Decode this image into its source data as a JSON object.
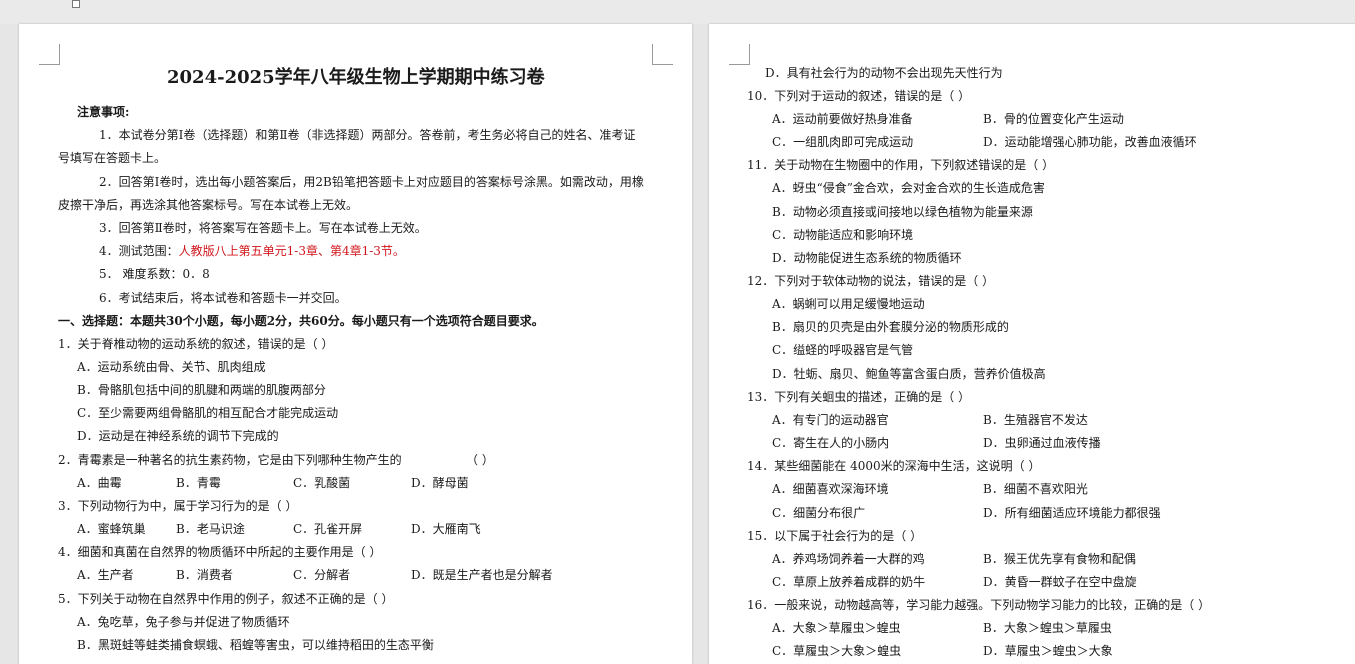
{
  "left": {
    "title": "2024-2025学年八年级生物上学期期中练习卷",
    "notice_heading": "注意事项:",
    "n1a": "1．本试卷分第Ⅰ卷（选择题）和第Ⅱ卷（非选择题）两部分。答卷前，考生务必将自己的姓名、准考证",
    "n1b": "号填写在答题卡上。",
    "n2a": "2．回答第Ⅰ卷时，选出每小题答案后，用2B铅笔把答题卡上对应题目的答案标号涂黑。如需改动，用橡",
    "n2b": "皮擦干净后，再选涂其他答案标号。写在本试卷上无效。",
    "n3": "3．回答第Ⅱ卷时，将答案写在答题卡上。写在本试卷上无效。",
    "n4_prefix": "4．测试范围：",
    "n4_range": "人教版八上第五单元1-3章、第4章1-3节。",
    "n5": "5．  难度系数：0．8",
    "n6": "6．考试结束后，将本试卷和答题卡一并交回。",
    "section": "一、选择题：本题共30个小题，每小题2分，共60分。每小题只有一个选项符合题目要求。",
    "q1": "1．关于脊椎动物的运动系统的叙述，错误的是（    ）",
    "q1A": "A．运动系统由骨、关节、肌肉组成",
    "q1B": "B．骨骼肌包括中间的肌腱和两端的肌腹两部分",
    "q1C": "C．至少需要两组骨骼肌的相互配合才能完成运动",
    "q1D": "D．运动是在神经系统的调节下完成的",
    "q2": "2．青霉素是一种著名的抗生素药物，它是由下列哪种生物产生的",
    "q2p": "（       ）",
    "q2A": "A．曲霉",
    "q2B": "B．青霉",
    "q2C": "C．乳酸菌",
    "q2D": "D．酵母菌",
    "q3": "3．下列动物行为中，属于学习行为的是（     ）",
    "q3A": "A．蜜蜂筑巢",
    "q3B": "B．老马识途",
    "q3C": "C．孔雀开屏",
    "q3D": "D．大雁南飞",
    "q4": "4．细菌和真菌在自然界的物质循环中所起的主要作用是（               ）",
    "q4A": "A．生产者",
    "q4B": "B．消费者",
    "q4C": "C．分解者",
    "q4D": "D．既是生产者也是分解者",
    "q5": "5．下列关于动物在自然界中作用的例子，叙述不正确的是（     ）",
    "q5A": "A．兔吃草，兔子参与并促进了物质循环",
    "q5B": "B．黑斑蛙等蛙类捕食螟蛾、稻蝗等害虫，可以维持稻田的生态平衡"
  },
  "right": {
    "q9D": "D．具有社会行为的动物不会出现先天性行为",
    "q10": "10．下列对于运动的叙述，错误的是（          ）",
    "q10A": "A．运动前要做好热身准备",
    "q10B": "B．骨的位置变化产生运动",
    "q10C": "C．一组肌肉即可完成运动",
    "q10D": "D．运动能增强心肺功能，改善血液循环",
    "q11": "11．关于动物在生物圈中的作用，下列叙述错误的是（      ）",
    "q11A": "A．蚜虫“侵食”金合欢，会对金合欢的生长造成危害",
    "q11B": "B．动物必须直接或间接地以绿色植物为能量来源",
    "q11C": "C．动物能适应和影响环境",
    "q11D": "D．动物能促进生态系统的物质循环",
    "q12": "12．下列对于软体动物的说法，错误的是（          ）",
    "q12A": "A．蜗蜊可以用足缓慢地运动",
    "q12B": "B．扇贝的贝壳是由外套膜分泌的物质形成的",
    "q12C": "C．缢蛏的呼吸器官是气管",
    "q12D": "D．牡蛎、扇贝、鲍鱼等富含蛋白质，营养价值极高",
    "q13": "13．下列有关蛔虫的描述，正确的是（      ）",
    "q13A": "A．有专门的运动器官",
    "q13B": "B．生殖器官不发达",
    "q13C": "C．寄生在人的小肠内",
    "q13D": "D．虫卵通过血液传播",
    "q14": "14．某些细菌能在 4000米的深海中生活，这说明（       ）",
    "q14A": "A．细菌喜欢深海环境",
    "q14B": "B．细菌不喜欢阳光",
    "q14C": "C．细菌分布很广",
    "q14D": "D．所有细菌适应环境能力都很强",
    "q15": "15．以下属于社会行为的是（          ）",
    "q15A": "A．养鸡场饲养着一大群的鸡",
    "q15B": "B．猴王优先享有食物和配偶",
    "q15C": "C．草原上放养着成群的奶牛",
    "q15D": "D．黄昏一群蚊子在空中盘旋",
    "q16": "16．一般来说，动物越高等，学习能力越强。下列动物学习能力的比较，正确的是（      ）",
    "q16A": "A．大象＞草履虫＞蝗虫",
    "q16B": "B．大象＞蝗虫＞草履虫",
    "q16C": "C．草履虫＞大象＞蝗虫",
    "q16D": "D．草履虫＞蝗虫＞大象"
  }
}
